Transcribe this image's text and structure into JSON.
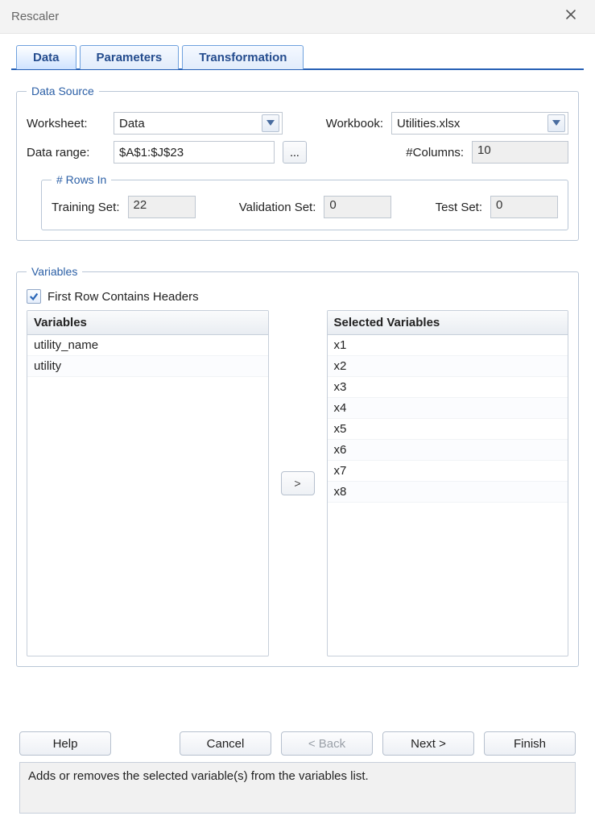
{
  "window": {
    "title": "Rescaler"
  },
  "tabs": [
    {
      "label": "Data"
    },
    {
      "label": "Parameters"
    },
    {
      "label": "Transformation"
    }
  ],
  "data_source": {
    "legend": "Data Source",
    "worksheet_label": "Worksheet:",
    "worksheet_value": "Data",
    "workbook_label": "Workbook:",
    "workbook_value": "Utilities.xlsx",
    "data_range_label": "Data range:",
    "data_range_value": "$A$1:$J$23",
    "columns_label": "#Columns:",
    "columns_value": "10",
    "rows_legend": "# Rows In",
    "training_label": "Training Set:",
    "training_value": "22",
    "validation_label": "Validation Set:",
    "validation_value": "0",
    "test_label": "Test Set:",
    "test_value": "0"
  },
  "variables": {
    "legend": "Variables",
    "headers_checkbox_label": "First Row Contains Headers",
    "headers_checked": true,
    "left_header": "Variables",
    "right_header": "Selected Variables",
    "left_items": [
      "utility_name",
      "utility"
    ],
    "right_items": [
      "x1",
      "x2",
      "x3",
      "x4",
      "x5",
      "x6",
      "x7",
      "x8"
    ],
    "move_label": ">"
  },
  "buttons": {
    "help": "Help",
    "cancel": "Cancel",
    "back": "< Back",
    "next": "Next >",
    "finish": "Finish"
  },
  "status_text": "Adds or removes the selected variable(s) from the variables list."
}
